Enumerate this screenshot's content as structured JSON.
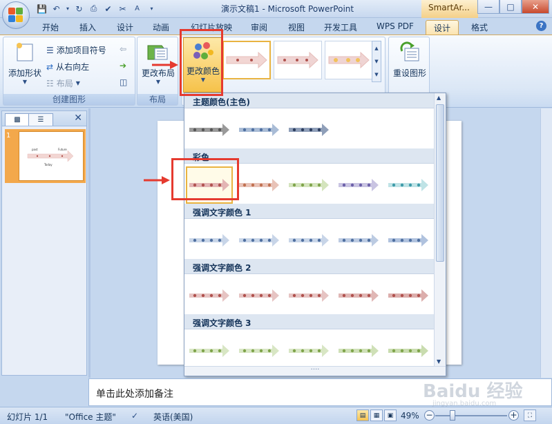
{
  "titlebar": {
    "title": "演示文稿1 - Microsoft PowerPoint",
    "context_tab_title": "SmartAr..."
  },
  "tabs": [
    "开始",
    "插入",
    "设计",
    "动画",
    "幻灯片放映",
    "审阅",
    "视图",
    "开发工具",
    "WPS PDF",
    "设计",
    "格式"
  ],
  "active_tab_index": 9,
  "ribbon": {
    "create_group": {
      "label": "创建图形",
      "add_shape": "添加形状",
      "add_bullet": "添加项目符号",
      "right_to_left": "从右向左",
      "layout": "布局"
    },
    "layout_group": {
      "label": "布局",
      "change_layout": "更改布局"
    },
    "change_color": "更改颜色",
    "reset_graphic": "重设图形"
  },
  "dropdown": {
    "sections": [
      {
        "title": "主题颜色(主色)",
        "styles": [
          {
            "line": "#9a9a9a",
            "dot": "#555555"
          },
          {
            "line": "#a9bcd6",
            "dot": "#4f6f9f"
          },
          {
            "line": "#8f9fb9",
            "dot": "#2c3d5e"
          }
        ]
      },
      {
        "title": "彩色",
        "styles": [
          {
            "line": "#e3b5b4",
            "dot": "#b0524e"
          },
          {
            "line": "#e8c3b8",
            "dot": "#c0704f"
          },
          {
            "line": "#d4e4bd",
            "dot": "#7ea34a"
          },
          {
            "line": "#c9c4e2",
            "dot": "#6b5fa8"
          },
          {
            "line": "#bfe3e6",
            "dot": "#3d9aa8"
          }
        ]
      },
      {
        "title": "强调文字颜色 1",
        "styles": [
          {
            "line": "#c8d5e8",
            "dot": "#4f6f9f"
          },
          {
            "line": "#c8d5e8",
            "dot": "#4f6f9f"
          },
          {
            "line": "#c8d5e8",
            "dot": "#4f6f9f"
          },
          {
            "line": "#bccbe2",
            "dot": "#4f6f9f"
          },
          {
            "line": "#b0c2de",
            "dot": "#4f6f9f"
          }
        ]
      },
      {
        "title": "强调文字颜色 2",
        "styles": [
          {
            "line": "#e6c4c3",
            "dot": "#b0524e"
          },
          {
            "line": "#e6c4c3",
            "dot": "#b0524e"
          },
          {
            "line": "#e6c4c3",
            "dot": "#b0524e"
          },
          {
            "line": "#e0b7b5",
            "dot": "#b0524e"
          },
          {
            "line": "#dcaeac",
            "dot": "#b0524e"
          }
        ]
      },
      {
        "title": "强调文字颜色 3",
        "styles": [
          {
            "line": "#d8e6c4",
            "dot": "#7ea34a"
          },
          {
            "line": "#d8e6c4",
            "dot": "#7ea34a"
          },
          {
            "line": "#d8e6c4",
            "dot": "#7ea34a"
          },
          {
            "line": "#cfe0b7",
            "dot": "#7ea34a"
          },
          {
            "line": "#c9dcaf",
            "dot": "#7ea34a"
          }
        ]
      }
    ],
    "selected": {
      "section": 1,
      "index": 0
    }
  },
  "thumbnail": {
    "labels": [
      "past",
      "Future",
      "Today"
    ]
  },
  "notes_placeholder": "单击此处添加备注",
  "statusbar": {
    "slide_info": "幻灯片 1/1",
    "theme": "\"Office 主题\"",
    "language": "英语(美国)",
    "zoom": "49%",
    "zoom_level": 0.49
  },
  "watermark": {
    "main": "Baidu 经验",
    "sub": "jingyan.baidu.com"
  },
  "colors": {
    "highlight": "#e53a2f",
    "selection": "#e9b340"
  }
}
